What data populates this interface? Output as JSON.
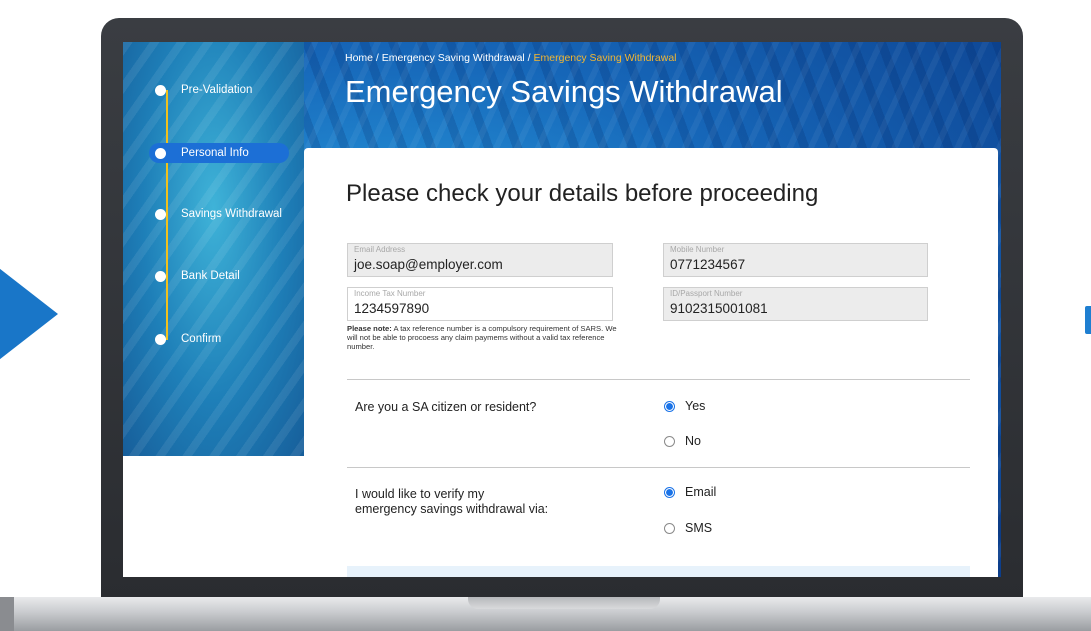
{
  "breadcrumb": {
    "home": "Home",
    "sep1": " / ",
    "parent": "Emergency Saving Withdrawal",
    "sep2": " / ",
    "current": "Emergency Saving Withdrawal"
  },
  "page_title": "Emergency Savings Withdrawal",
  "stepper": {
    "steps": [
      {
        "label": "Pre-Validation"
      },
      {
        "label": "Personal Info"
      },
      {
        "label": "Savings Withdrawal"
      },
      {
        "label": "Bank Detail"
      },
      {
        "label": "Confirm"
      }
    ],
    "active_step": "Personal Info"
  },
  "form": {
    "heading": "Please check your details before proceeding",
    "fields": {
      "email": {
        "label": "Email Address",
        "value": "joe.soap@employer.com"
      },
      "mobile": {
        "label": "Mobile Number",
        "value": "0771234567"
      },
      "tax": {
        "label": "Income Tax Number",
        "value": "1234597890"
      },
      "id": {
        "label": "ID/Passport Number",
        "value": "9102315001081"
      }
    },
    "note": {
      "title": "Please note:",
      "text": " A tax reference number is a compulsory requirement of SARS. We will not be able to procoess any claim paymems without a valid tax reference number."
    },
    "citizen_question": {
      "question": "Are you a SA citizen or resident?",
      "options": [
        "Yes",
        "No"
      ],
      "selected": "Yes"
    },
    "verify_question": {
      "question_line1": "I would like to verify my",
      "question_line2": "emergency  savings withdrawal via:",
      "options": [
        "Email",
        "SMS"
      ],
      "selected": "Email"
    }
  },
  "colors": {
    "accent_blue": "#1c6fd6",
    "stepper_line": "#f2c11b",
    "breadcrumb_current": "#f2b632",
    "side_arrow": "#1976c8"
  }
}
